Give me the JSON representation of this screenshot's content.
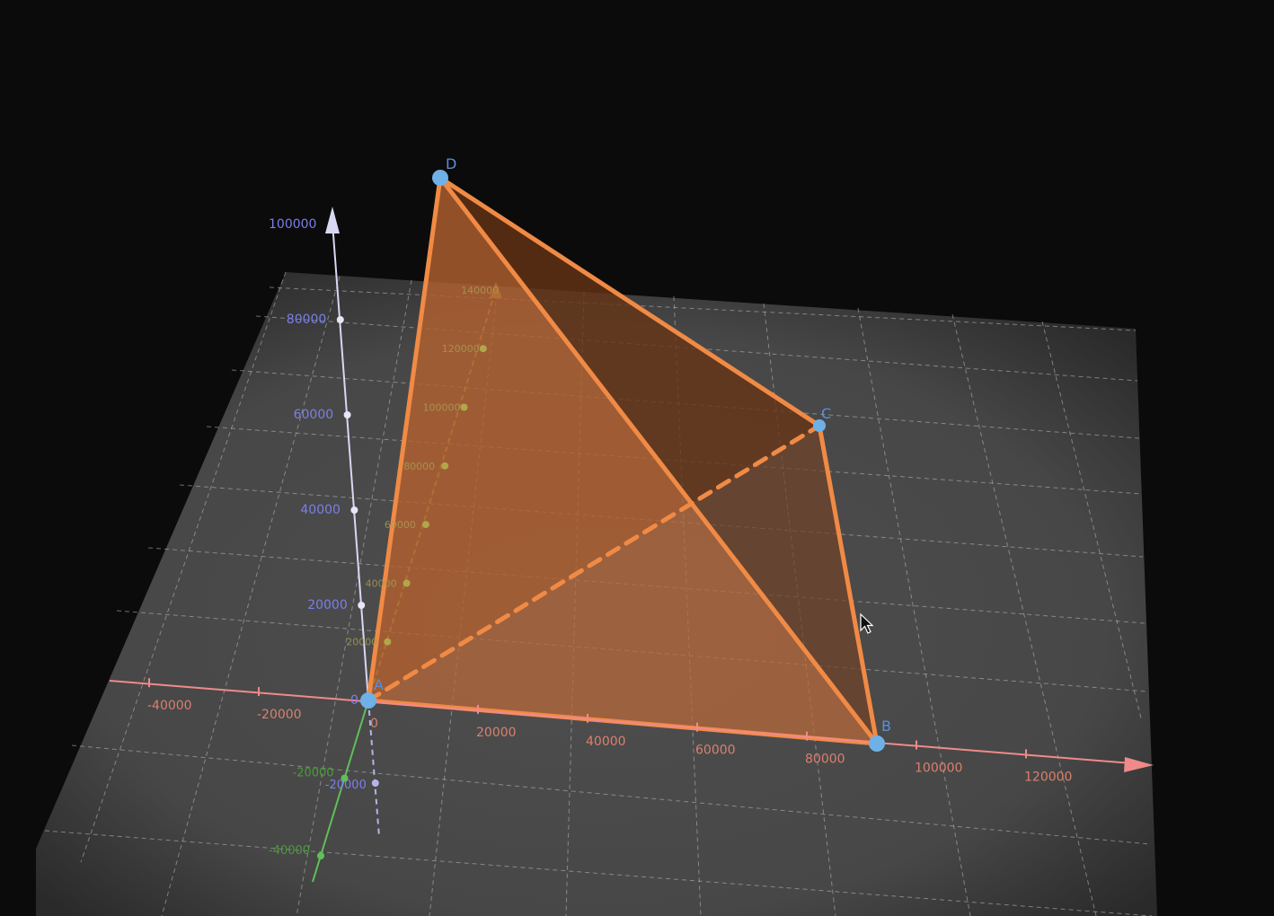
{
  "scene": {
    "background": "#0b0b0b",
    "plane_color": "#454545",
    "grid_color": "#c8c8c8",
    "solid": {
      "name": "tetrahedron",
      "vertices": [
        "A",
        "B",
        "C",
        "D"
      ],
      "fill_color": "#c9703a",
      "edge_color": "#f08a45",
      "point_color": "#6fb0e6",
      "label_color": "#5b8fd8"
    },
    "points": [
      {
        "label": "A"
      },
      {
        "label": "B"
      },
      {
        "label": "C"
      },
      {
        "label": "D"
      }
    ]
  },
  "axes": {
    "x": {
      "color": "#f08a8a",
      "label_color": "#d9806e",
      "ticks": [
        "-40000",
        "-20000",
        "0",
        "20000",
        "40000",
        "60000",
        "80000",
        "100000",
        "120000"
      ]
    },
    "y": {
      "color": "#b0a74a",
      "negative_color": "#5fc05a",
      "label_color_positive": "#a79a55",
      "label_color_negative": "#4a9a3a",
      "ticks_positive": [
        "20000",
        "40000",
        "60000",
        "80000",
        "100000",
        "120000",
        "140000"
      ],
      "ticks_negative": [
        "-20000",
        "-40000"
      ]
    },
    "z": {
      "color": "#d8d8f4",
      "label_color": "#7a7fe8",
      "ticks": [
        "0",
        "20000",
        "40000",
        "60000",
        "80000",
        "100000"
      ],
      "ticks_negative": [
        "-20000"
      ]
    }
  },
  "cursor": {
    "icon": "arrow-cursor-icon"
  }
}
